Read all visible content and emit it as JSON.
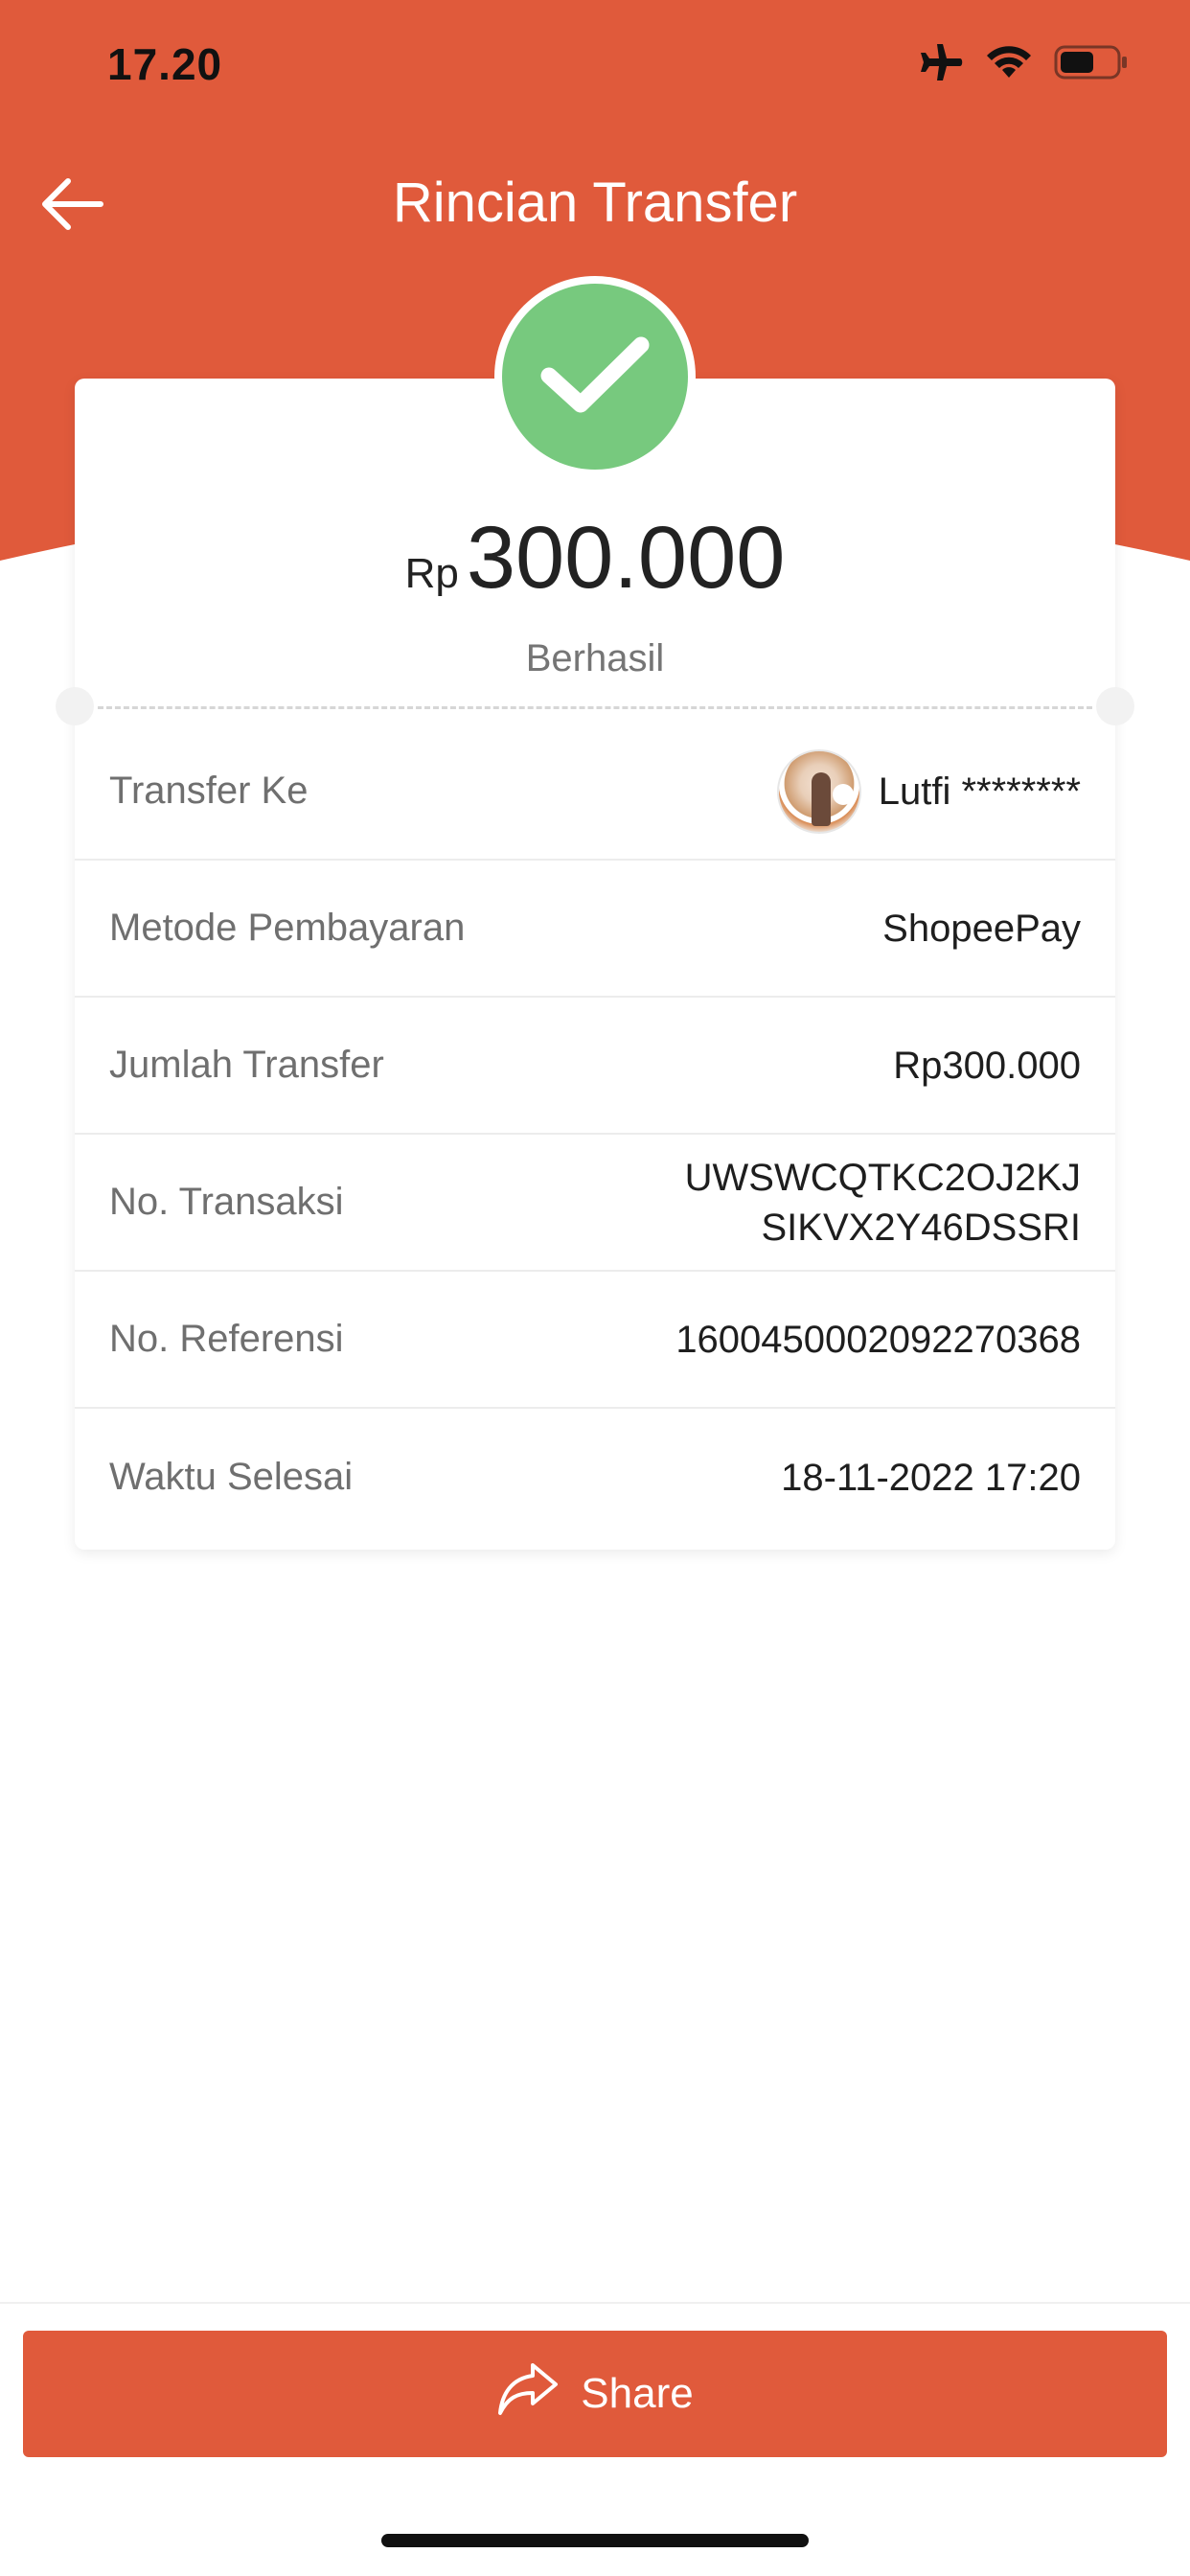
{
  "colors": {
    "brand": "#e05a3b",
    "success": "#77c97e"
  },
  "status_bar": {
    "time": "17.20",
    "icons": [
      "airplane-icon",
      "wifi-icon",
      "battery-icon"
    ]
  },
  "header": {
    "title": "Rincian Transfer",
    "back_icon": "arrow-left-icon"
  },
  "summary": {
    "currency": "Rp",
    "amount": "300.000",
    "status": "Berhasil",
    "status_icon": "checkmark-icon"
  },
  "details": {
    "transfer_to": {
      "label": "Transfer Ke",
      "value": "Lutfi ********"
    },
    "payment_method": {
      "label": "Metode Pembayaran",
      "value": "ShopeePay"
    },
    "transfer_amount": {
      "label": "Jumlah Transfer",
      "value": "Rp300.000"
    },
    "transaction_no": {
      "label": "No. Transaksi",
      "line1": "UWSWCQTKC2OJ2KJ",
      "line2": "SIKVX2Y46DSSRI"
    },
    "reference_no": {
      "label": "No. Referensi",
      "value": "1600450002092270368"
    },
    "completed_time": {
      "label": "Waktu Selesai",
      "value": "18-11-2022 17:20"
    }
  },
  "footer": {
    "share_label": "Share",
    "share_icon": "share-arrow-icon"
  }
}
